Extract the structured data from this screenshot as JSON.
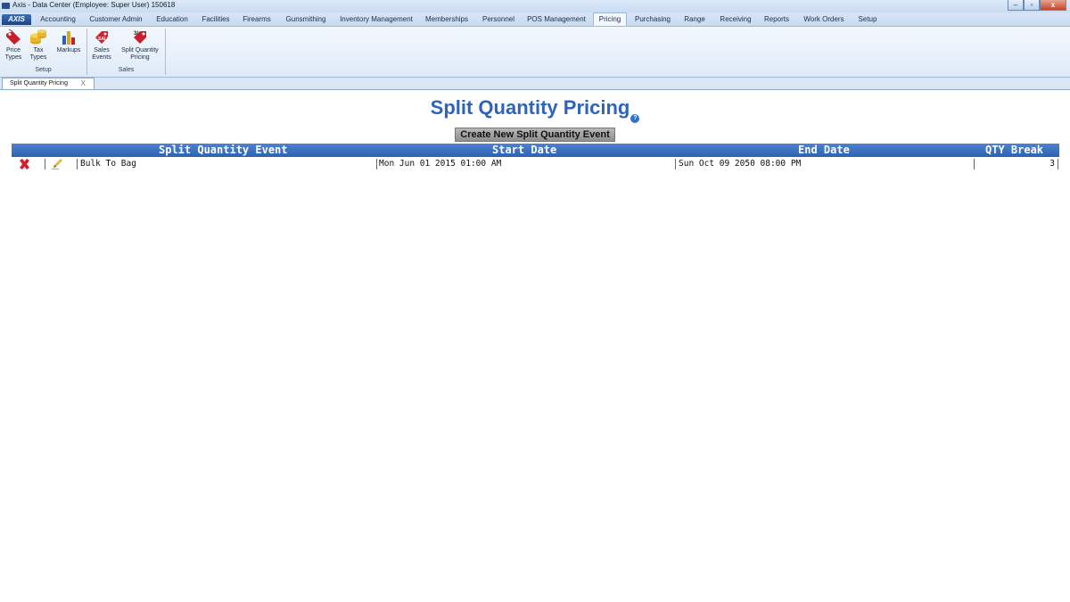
{
  "window": {
    "title": "Axis - Data Center  (Employee: Super User) 150618",
    "minimize_label": "–",
    "maximize_label": "▫",
    "close_label": "x"
  },
  "app_button": "AXIS",
  "menu_tabs": [
    "Accounting",
    "Customer Admin",
    "Education",
    "Facilities",
    "Firearms",
    "Gunsmithing",
    "Inventory Management",
    "Memberships",
    "Personnel",
    "POS Management",
    "Pricing",
    "Purchasing",
    "Range",
    "Receiving",
    "Reports",
    "Work Orders",
    "Setup"
  ],
  "active_tab": "Pricing",
  "ribbon": {
    "price_types": [
      "Price",
      "Types"
    ],
    "tax_types": [
      "Tax",
      "Types"
    ],
    "markups": "Markups",
    "sales_events": [
      "Sales",
      "Events"
    ],
    "split_quantity_pricing": [
      "Split Quantity",
      "Pricing"
    ],
    "group_setup": "Setup",
    "group_sales": "Sales"
  },
  "doc_tab": {
    "label": "Split Quantity Pricing",
    "close": "X"
  },
  "page": {
    "title": "Split Quantity Pricing",
    "help": "?",
    "create_button": "Create New Split Quantity Event"
  },
  "grid": {
    "columns": [
      "Split Quantity Event",
      "Start Date",
      "End Date",
      "QTY Break"
    ],
    "rows": [
      {
        "event": "Bulk To Bag",
        "start": "Mon Jun 01 2015 01:00 AM",
        "end": "Sun Oct 09 2050 08:00 PM",
        "qty_break": "3"
      }
    ]
  }
}
